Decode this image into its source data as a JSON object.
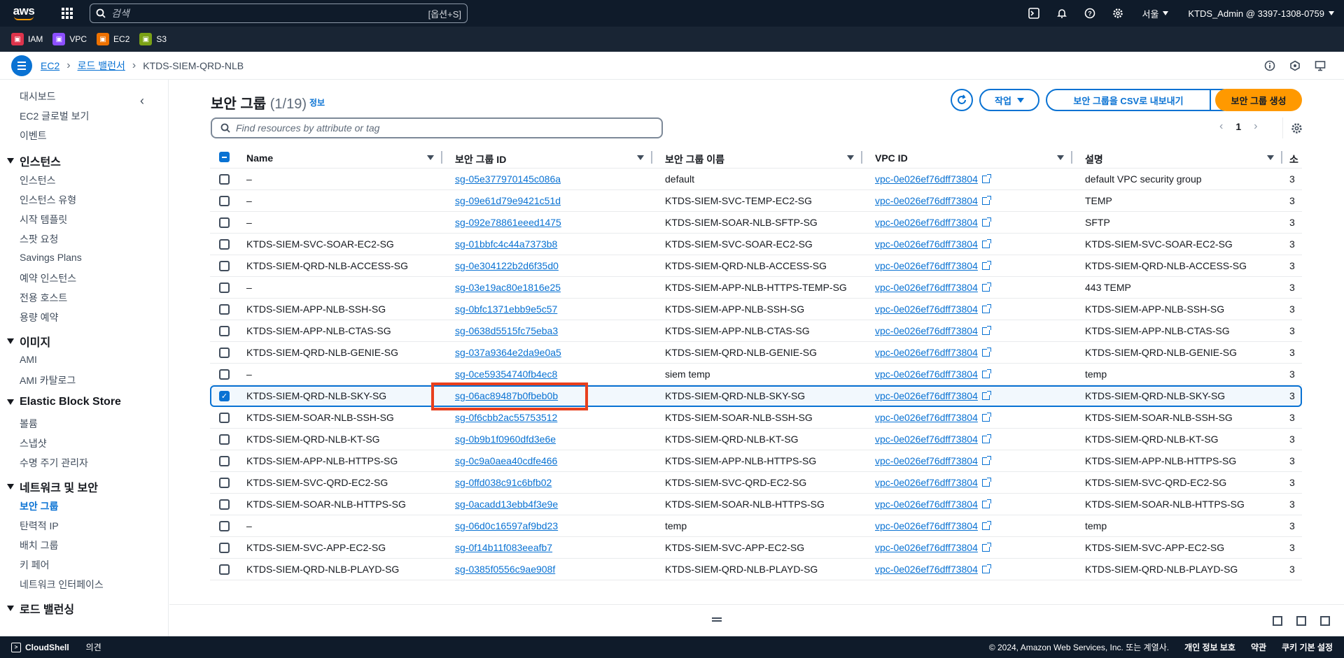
{
  "topnav": {
    "logo": "aws",
    "search_placeholder": "검색",
    "search_shortcut": "[옵션+S]",
    "region": "서울",
    "account": "KTDS_Admin @ 3397-1308-0759"
  },
  "favorites": [
    {
      "label": "IAM",
      "color": "#dd344c"
    },
    {
      "label": "VPC",
      "color": "#8c4fff"
    },
    {
      "label": "EC2",
      "color": "#ed7100"
    },
    {
      "label": "S3",
      "color": "#7aa116"
    }
  ],
  "breadcrumb": {
    "items": [
      "EC2",
      "로드 밸런서"
    ],
    "current": "KTDS-SIEM-QRD-NLB"
  },
  "sidebar": {
    "top_items": [
      "대시보드",
      "EC2 글로벌 보기",
      "이벤트"
    ],
    "sections": [
      {
        "title": "인스턴스",
        "items": [
          "인스턴스",
          "인스턴스 유형",
          "시작 템플릿",
          "스팟 요청",
          "Savings Plans",
          "예약 인스턴스",
          "전용 호스트",
          "용량 예약"
        ]
      },
      {
        "title": "이미지",
        "items": [
          "AMI",
          "AMI 카탈로그"
        ]
      },
      {
        "title": "Elastic Block Store",
        "items": [
          "볼륨",
          "스냅샷",
          "수명 주기 관리자"
        ]
      },
      {
        "title": "네트워크 및 보안",
        "items": [
          "보안 그룹",
          "탄력적 IP",
          "배치 그룹",
          "키 페어",
          "네트워크 인터페이스"
        ]
      },
      {
        "title": "로드 밸런싱",
        "items": []
      }
    ],
    "active_item": "보안 그룹"
  },
  "header": {
    "title": "보안 그룹",
    "count": "(1/19)",
    "info": "정보",
    "actions_label": "작업",
    "export_label": "보안 그룹을 CSV로 내보내기",
    "create_label": "보안 그룹 생성"
  },
  "filter": {
    "placeholder": "Find resources by attribute or tag"
  },
  "pagination": {
    "page": "1"
  },
  "table": {
    "columns": [
      "Name",
      "보안 그룹 ID",
      "보안 그룹 이름",
      "VPC ID",
      "설명",
      "소"
    ],
    "rows": [
      {
        "name": "–",
        "id": "sg-05e377970145c086a",
        "group_name": "default",
        "vpc": "vpc-0e026ef76dff73804",
        "desc": "default VPC security group",
        "owner": "3",
        "selected": false
      },
      {
        "name": "–",
        "id": "sg-09e61d79e9421c51d",
        "group_name": "KTDS-SIEM-SVC-TEMP-EC2-SG",
        "vpc": "vpc-0e026ef76dff73804",
        "desc": "TEMP",
        "owner": "3",
        "selected": false
      },
      {
        "name": "–",
        "id": "sg-092e78861eeed1475",
        "group_name": "KTDS-SIEM-SOAR-NLB-SFTP-SG",
        "vpc": "vpc-0e026ef76dff73804",
        "desc": "SFTP",
        "owner": "3",
        "selected": false
      },
      {
        "name": "KTDS-SIEM-SVC-SOAR-EC2-SG",
        "id": "sg-01bbfc4c44a7373b8",
        "group_name": "KTDS-SIEM-SVC-SOAR-EC2-SG",
        "vpc": "vpc-0e026ef76dff73804",
        "desc": "KTDS-SIEM-SVC-SOAR-EC2-SG",
        "owner": "3",
        "selected": false
      },
      {
        "name": "KTDS-SIEM-QRD-NLB-ACCESS-SG",
        "id": "sg-0e304122b2d6f35d0",
        "group_name": "KTDS-SIEM-QRD-NLB-ACCESS-SG",
        "vpc": "vpc-0e026ef76dff73804",
        "desc": "KTDS-SIEM-QRD-NLB-ACCESS-SG",
        "owner": "3",
        "selected": false
      },
      {
        "name": "–",
        "id": "sg-03e19ac80e1816e25",
        "group_name": "KTDS-SIEM-APP-NLB-HTTPS-TEMP-SG",
        "vpc": "vpc-0e026ef76dff73804",
        "desc": "443 TEMP",
        "owner": "3",
        "selected": false
      },
      {
        "name": "KTDS-SIEM-APP-NLB-SSH-SG",
        "id": "sg-0bfc1371ebb9e5c57",
        "group_name": "KTDS-SIEM-APP-NLB-SSH-SG",
        "vpc": "vpc-0e026ef76dff73804",
        "desc": "KTDS-SIEM-APP-NLB-SSH-SG",
        "owner": "3",
        "selected": false
      },
      {
        "name": "KTDS-SIEM-APP-NLB-CTAS-SG",
        "id": "sg-0638d5515fc75eba3",
        "group_name": "KTDS-SIEM-APP-NLB-CTAS-SG",
        "vpc": "vpc-0e026ef76dff73804",
        "desc": "KTDS-SIEM-APP-NLB-CTAS-SG",
        "owner": "3",
        "selected": false
      },
      {
        "name": "KTDS-SIEM-QRD-NLB-GENIE-SG",
        "id": "sg-037a9364e2da9e0a5",
        "group_name": "KTDS-SIEM-QRD-NLB-GENIE-SG",
        "vpc": "vpc-0e026ef76dff73804",
        "desc": "KTDS-SIEM-QRD-NLB-GENIE-SG",
        "owner": "3",
        "selected": false
      },
      {
        "name": "–",
        "id": "sg-0ce59354740fb4ec8",
        "group_name": "siem temp",
        "vpc": "vpc-0e026ef76dff73804",
        "desc": "temp",
        "owner": "3",
        "selected": false
      },
      {
        "name": "KTDS-SIEM-QRD-NLB-SKY-SG",
        "id": "sg-06ac89487b0fbeb0b",
        "group_name": "KTDS-SIEM-QRD-NLB-SKY-SG",
        "vpc": "vpc-0e026ef76dff73804",
        "desc": "KTDS-SIEM-QRD-NLB-SKY-SG",
        "owner": "3",
        "selected": true
      },
      {
        "name": "KTDS-SIEM-SOAR-NLB-SSH-SG",
        "id": "sg-0f6cbb2ac55753512",
        "group_name": "KTDS-SIEM-SOAR-NLB-SSH-SG",
        "vpc": "vpc-0e026ef76dff73804",
        "desc": "KTDS-SIEM-SOAR-NLB-SSH-SG",
        "owner": "3",
        "selected": false
      },
      {
        "name": "KTDS-SIEM-QRD-NLB-KT-SG",
        "id": "sg-0b9b1f0960dfd3e6e",
        "group_name": "KTDS-SIEM-QRD-NLB-KT-SG",
        "vpc": "vpc-0e026ef76dff73804",
        "desc": "KTDS-SIEM-QRD-NLB-KT-SG",
        "owner": "3",
        "selected": false
      },
      {
        "name": "KTDS-SIEM-APP-NLB-HTTPS-SG",
        "id": "sg-0c9a0aea40cdfe466",
        "group_name": "KTDS-SIEM-APP-NLB-HTTPS-SG",
        "vpc": "vpc-0e026ef76dff73804",
        "desc": "KTDS-SIEM-APP-NLB-HTTPS-SG",
        "owner": "3",
        "selected": false
      },
      {
        "name": "KTDS-SIEM-SVC-QRD-EC2-SG",
        "id": "sg-0ffd038c91c6bfb02",
        "group_name": "KTDS-SIEM-SVC-QRD-EC2-SG",
        "vpc": "vpc-0e026ef76dff73804",
        "desc": "KTDS-SIEM-SVC-QRD-EC2-SG",
        "owner": "3",
        "selected": false
      },
      {
        "name": "KTDS-SIEM-SOAR-NLB-HTTPS-SG",
        "id": "sg-0acadd13ebb4f3e9e",
        "group_name": "KTDS-SIEM-SOAR-NLB-HTTPS-SG",
        "vpc": "vpc-0e026ef76dff73804",
        "desc": "KTDS-SIEM-SOAR-NLB-HTTPS-SG",
        "owner": "3",
        "selected": false
      },
      {
        "name": "–",
        "id": "sg-06d0c16597af9bd23",
        "group_name": "temp",
        "vpc": "vpc-0e026ef76dff73804",
        "desc": "temp",
        "owner": "3",
        "selected": false
      },
      {
        "name": "KTDS-SIEM-SVC-APP-EC2-SG",
        "id": "sg-0f14b11f083eeafb7",
        "group_name": "KTDS-SIEM-SVC-APP-EC2-SG",
        "vpc": "vpc-0e026ef76dff73804",
        "desc": "KTDS-SIEM-SVC-APP-EC2-SG",
        "owner": "3",
        "selected": false
      },
      {
        "name": "KTDS-SIEM-QRD-NLB-PLAYD-SG",
        "id": "sg-0385f0556c9ae908f",
        "group_name": "KTDS-SIEM-QRD-NLB-PLAYD-SG",
        "vpc": "vpc-0e026ef76dff73804",
        "desc": "KTDS-SIEM-QRD-NLB-PLAYD-SG",
        "owner": "3",
        "selected": false
      }
    ]
  },
  "footer": {
    "cloudshell": "CloudShell",
    "feedback": "의견",
    "copyright": "© 2024, Amazon Web Services, Inc. 또는 계열사.",
    "privacy": "개인 정보 보호",
    "terms": "약관",
    "cookies": "쿠키 기본 설정"
  }
}
